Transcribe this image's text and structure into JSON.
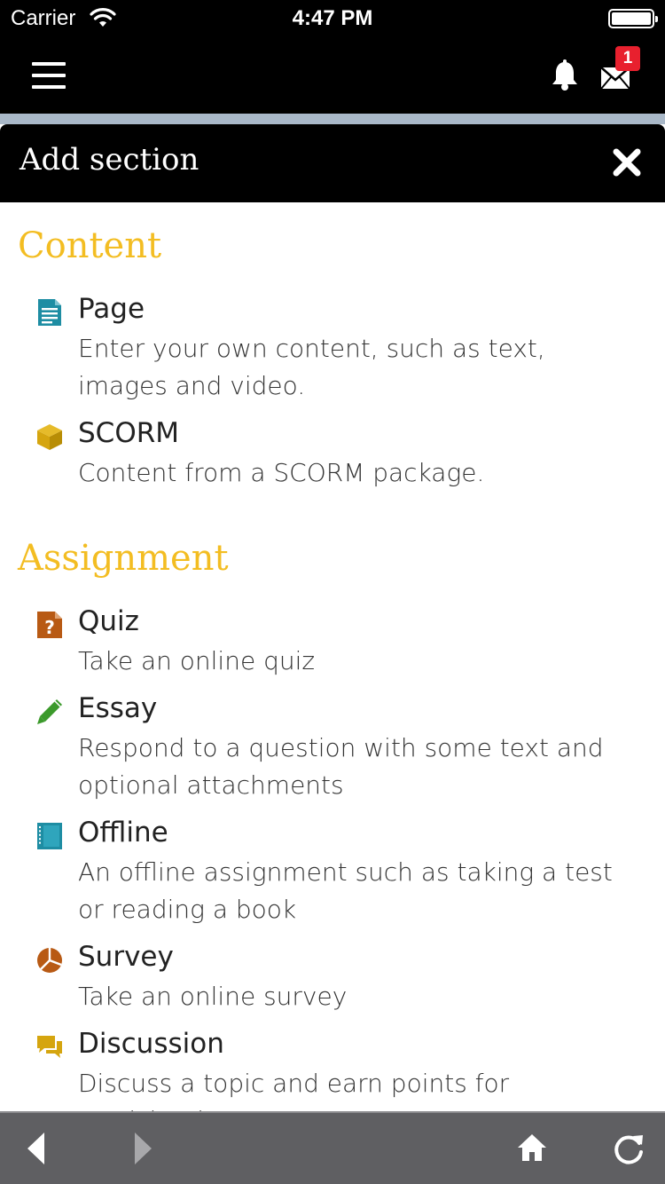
{
  "status_bar": {
    "carrier": "Carrier",
    "time": "4:47 PM"
  },
  "header": {
    "menu_icon": "hamburger-menu-icon",
    "bell_icon": "bell-icon",
    "mail_icon": "envelope-icon",
    "mail_badge": "1",
    "badge_color": "#e8202e"
  },
  "modal": {
    "title": "Add section",
    "close_icon": "close-icon",
    "heading_color": "#f3bd22",
    "sections": [
      {
        "heading": "Content",
        "items": [
          {
            "title": "Page",
            "description": "Enter your own content, such as text, images and video.",
            "icon": "page-document-icon",
            "icon_color": "#1e8da3"
          },
          {
            "title": "SCORM",
            "description": "Content from a SCORM package.",
            "icon": "package-cube-icon",
            "icon_color": "#d5a50f"
          }
        ]
      },
      {
        "heading": "Assignment",
        "items": [
          {
            "title": "Quiz",
            "description": "Take an online quiz",
            "icon": "quiz-question-icon",
            "icon_color": "#b85a14"
          },
          {
            "title": "Essay",
            "description": "Respond to a question with some text and optional attachments",
            "icon": "pencil-icon",
            "icon_color": "#3b9a2b"
          },
          {
            "title": "Offline",
            "description": "An offline assignment such as taking a test or reading a book",
            "icon": "notebook-icon",
            "icon_color": "#1e8da3"
          },
          {
            "title": "Survey",
            "description": "Take an online survey",
            "icon": "pie-chart-icon",
            "icon_color": "#b85a14"
          },
          {
            "title": "Discussion",
            "description": "Discuss a topic and earn points for participation",
            "icon": "discussion-bubbles-icon",
            "icon_color": "#d5a50f"
          }
        ]
      }
    ]
  },
  "toolbar": {
    "back_icon": "back-arrow-icon",
    "forward_icon": "forward-arrow-icon",
    "home_icon": "home-icon",
    "reload_icon": "reload-icon"
  }
}
